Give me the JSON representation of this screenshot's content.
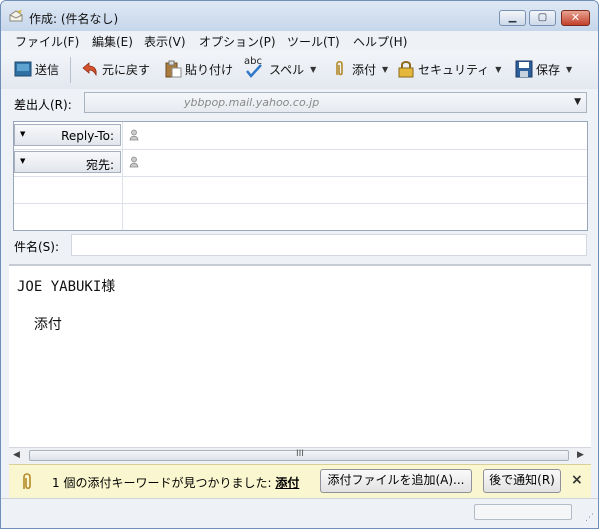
{
  "window": {
    "title": "作成: (件名なし)"
  },
  "menu": [
    "ファイル(F)",
    "編集(E)",
    "表示(V)",
    "オプション(P)",
    "ツール(T)",
    "ヘルプ(H)"
  ],
  "toolbar": {
    "send": "送信",
    "undo": "元に戻す",
    "paste": "貼り付け",
    "spell_badge": "abc",
    "spell": "スペル",
    "attach": "添付",
    "security": "セキュリティ",
    "save": "保存"
  },
  "from": {
    "label": "差出人(R):",
    "value": "ybbpop.mail.yahoo.co.jp"
  },
  "recipients": [
    {
      "type": "Reply-To:"
    },
    {
      "type": "宛先:"
    }
  ],
  "subject": {
    "label": "件名(S):",
    "value": ""
  },
  "body": {
    "line1": "JOE YABUKI様",
    "line2": "  添付"
  },
  "notification": {
    "text": "1 個の添付キーワードが見つかりました: ",
    "keyword": "添付",
    "add_button": "添付ファイルを追加(A)...",
    "later_button": "後で通知(R)",
    "close": "×"
  },
  "scrollbar": {
    "grip": "III"
  }
}
